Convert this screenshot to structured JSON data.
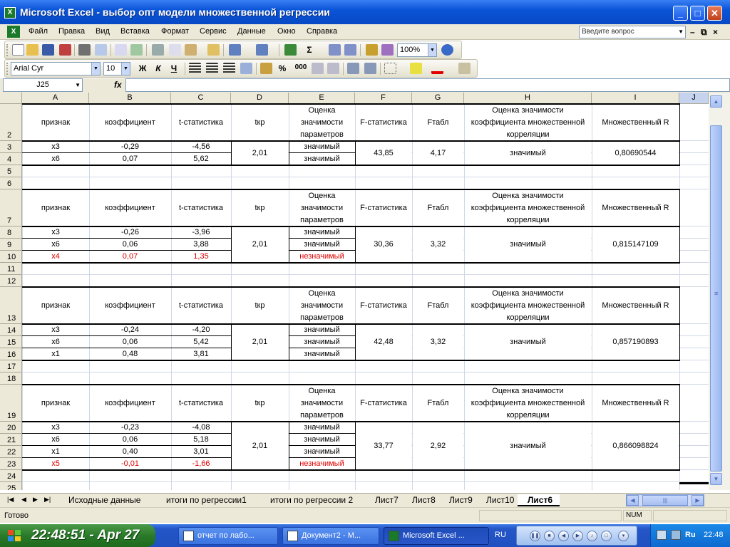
{
  "window": {
    "title": "Microsoft Excel - выбор опт модели множественной регрессии"
  },
  "menu": {
    "items": [
      "Файл",
      "Правка",
      "Вид",
      "Вставка",
      "Формат",
      "Сервис",
      "Данные",
      "Окно",
      "Справка"
    ],
    "question_placeholder": "Введите вопрос"
  },
  "toolbar": {
    "zoom": "100%",
    "font": "Arial Cyr",
    "size": "10",
    "bold": "Ж",
    "italic": "К",
    "underline": "Ч",
    "percent": "%",
    "thousands": "000"
  },
  "formula_bar": {
    "name_box": "J25",
    "fx": "fx",
    "formula": ""
  },
  "columns": [
    "A",
    "B",
    "C",
    "D",
    "E",
    "F",
    "G",
    "H",
    "I",
    "J"
  ],
  "rows": [
    "2",
    "3",
    "4",
    "5",
    "6",
    "7",
    "8",
    "9",
    "10",
    "11",
    "12",
    "13",
    "14",
    "15",
    "16",
    "17",
    "18",
    "19",
    "20",
    "21",
    "22",
    "23",
    "24",
    "25"
  ],
  "headers": {
    "a": "признак",
    "b": "коэффициент",
    "c": "t-статистика",
    "d": "tкр",
    "e": "Оценка значимости параметров",
    "f": "F-статистика",
    "g": "Fтабл",
    "h": "Оценка значимости коэффициента множественной корреляции",
    "i": "Множественный R"
  },
  "blocks": [
    {
      "rows": [
        {
          "a": "x3",
          "b": "-0,29",
          "c": "-4,56",
          "e": "значимый"
        },
        {
          "a": "x6",
          "b": "0,07",
          "c": "5,62",
          "e": "значимый"
        }
      ],
      "tkr": "2,01",
      "f": "43,85",
      "g": "4,17",
      "h": "значимый",
      "r": "0,80690544"
    },
    {
      "rows": [
        {
          "a": "x3",
          "b": "-0,26",
          "c": "-3,96",
          "e": "значимый"
        },
        {
          "a": "x6",
          "b": "0,06",
          "c": "3,88",
          "e": "значимый"
        },
        {
          "a": "x4",
          "b": "0,07",
          "c": "1,35",
          "e": "незначимый",
          "red": true
        }
      ],
      "tkr": "2,01",
      "f": "30,36",
      "g": "3,32",
      "h": "значимый",
      "r": "0,815147109"
    },
    {
      "rows": [
        {
          "a": "x3",
          "b": "-0,24",
          "c": "-4,20",
          "e": "значимый"
        },
        {
          "a": "x6",
          "b": "0,06",
          "c": "5,42",
          "e": "значимый"
        },
        {
          "a": "x1",
          "b": "0,48",
          "c": "3,81",
          "e": "значимый"
        }
      ],
      "tkr": "2,01",
      "f": "42,48",
      "g": "3,32",
      "h": "значимый",
      "r": "0,857190893"
    },
    {
      "rows": [
        {
          "a": "x3",
          "b": "-0,23",
          "c": "-4,08",
          "e": "значимый"
        },
        {
          "a": "x6",
          "b": "0,06",
          "c": "5,18",
          "e": "значимый"
        },
        {
          "a": "x1",
          "b": "0,40",
          "c": "3,01",
          "e": "значимый"
        },
        {
          "a": "x5",
          "b": "-0,01",
          "c": "-1,66",
          "e": "незначимый",
          "red": true
        }
      ],
      "tkr": "2,01",
      "f": "33,77",
      "g": "2,92",
      "h": "значимый",
      "r": "0,866098824"
    }
  ],
  "sheets": [
    "Исходные данные",
    "итоги по регрессии1",
    "итоги по регрессии 2",
    "Лист7",
    "Лист8",
    "Лист9",
    "Лист10",
    "Лист6"
  ],
  "active_sheet": "Лист6",
  "status": {
    "ready": "Готово",
    "num": "NUM"
  },
  "taskbar": {
    "clock": "22:48:51 - Apr 27",
    "tasks": [
      "отчет по лабо...",
      "Документ2 - М...",
      "Microsoft Excel ..."
    ],
    "lang": "RU",
    "tray_lang": "Ru",
    "tray_time": "22:48"
  },
  "colors": {
    "red": "#e00000",
    "title_blue": "#0a55d8",
    "taskbar_blue": "#2456c8"
  }
}
